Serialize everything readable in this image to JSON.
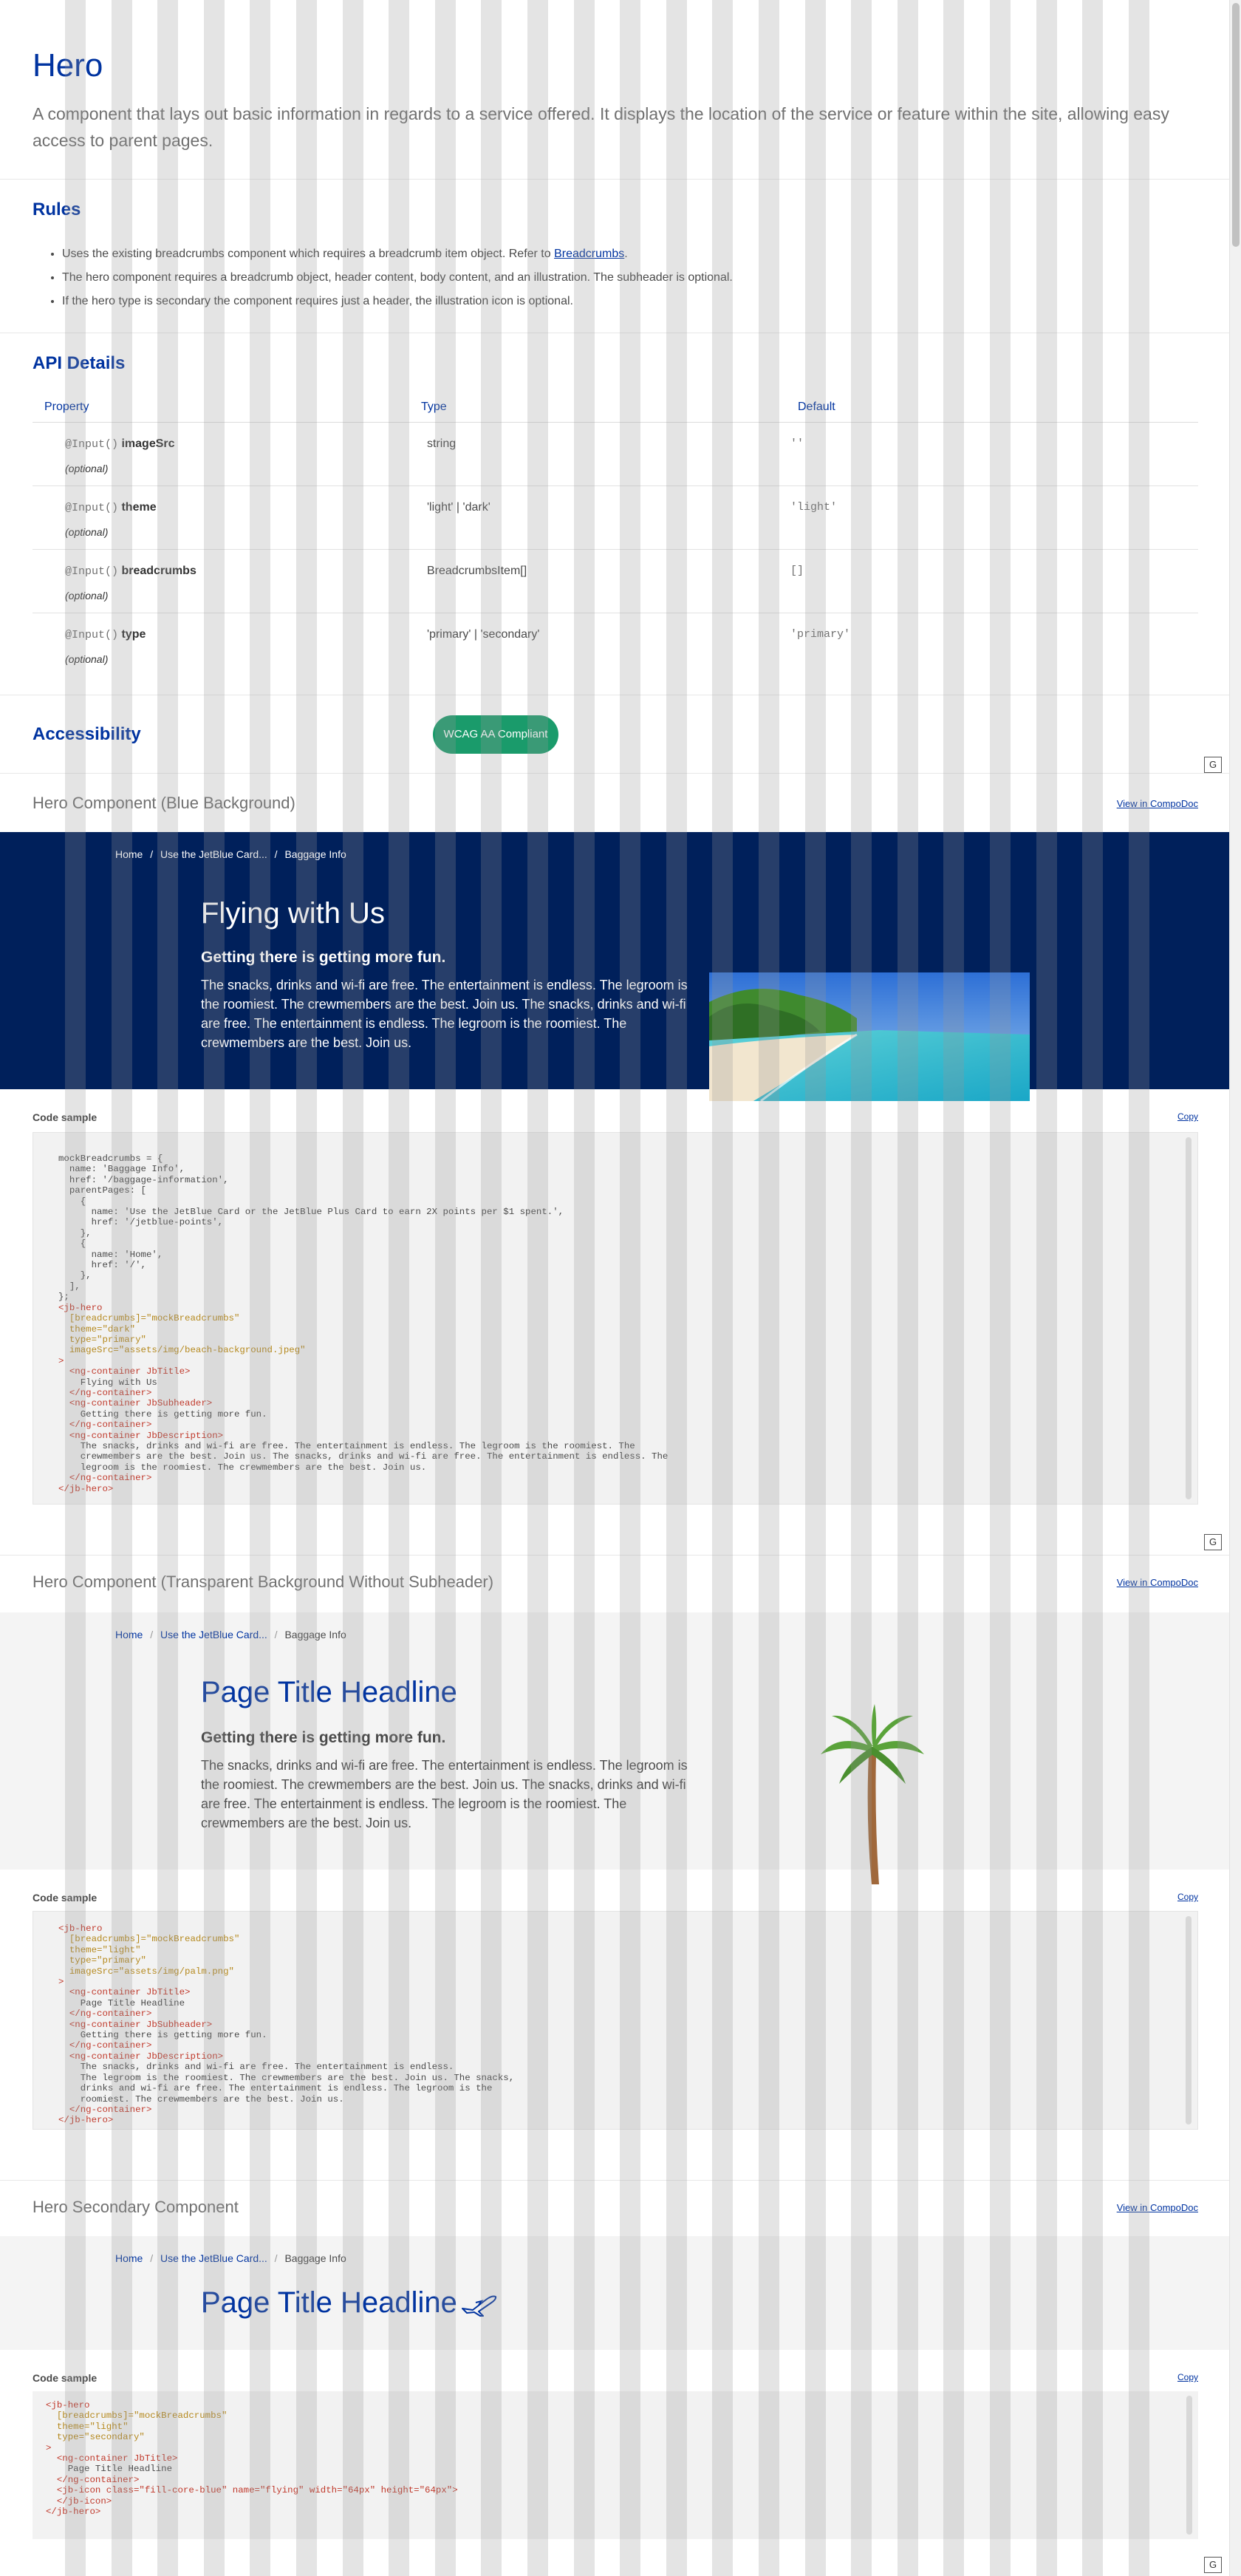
{
  "page": {
    "title": "Hero",
    "description": "A component that lays out basic information in regards to a service offered. It displays the location of the service or feature within the site, allowing easy access to parent pages."
  },
  "rules": {
    "heading": "Rules",
    "item1_prefix": "Uses the existing breadcrumbs component which requires a breadcrumb item object. Refer to",
    "item1_link": "Breadcrumbs",
    "item1_suffix": ".",
    "item2": "The hero component requires a breadcrumb object, header content, body content, and an illustration. The subheader is optional.",
    "item3": "If the hero type is secondary the component requires just a header, the illustration icon is optional."
  },
  "api": {
    "heading": "API Details",
    "columns": [
      "Property",
      "Type",
      "Default"
    ],
    "rows": [
      {
        "decorator": "@Input()",
        "name": "imageSrc",
        "optional": "(optional)",
        "type": "string",
        "default": "''"
      },
      {
        "decorator": "@Input()",
        "name": "theme",
        "optional": "(optional)",
        "type": "'light' | 'dark'",
        "default": "'light'"
      },
      {
        "decorator": "@Input()",
        "name": "breadcrumbs",
        "optional": "(optional)",
        "type": "BreadcrumbsItem[]",
        "default": "[]"
      },
      {
        "decorator": "@Input()",
        "name": "type",
        "optional": "(optional)",
        "type": "'primary' | 'secondary'",
        "default": "'primary'"
      }
    ]
  },
  "accessibility": {
    "heading": "Accessibility",
    "badge": "WCAG AA Compliant"
  },
  "grid_toggle": "G",
  "common": {
    "view_in_compodoc": "View in CompoDoc",
    "code_sample": "Code sample",
    "copy": "Copy"
  },
  "breadcrumb": {
    "home": "Home",
    "middle": "Use the JetBlue Card...",
    "current": "Baggage Info",
    "separator": "/"
  },
  "example1": {
    "title": "Hero Component (Blue Background)",
    "hero_title": "Flying with Us",
    "hero_subheader": "Getting there is getting more fun.",
    "hero_description": "The snacks, drinks and wi-fi are free. The entertainment is endless. The legroom is the roomiest. The crewmembers are the best. Join us. The snacks, drinks and wi-fi are free. The entertainment is endless. The legroom is the roomiest. The crewmembers are the best. Join us.",
    "colors": {
      "background": "#00205b"
    }
  },
  "example2": {
    "title": "Hero Component (Transparent Background Without Subheader)",
    "hero_title": "Page Title Headline",
    "hero_subheader": "Getting there is getting more fun.",
    "hero_description": "The snacks, drinks and wi-fi are free. The entertainment is endless. The legroom is the roomiest. The crewmembers are the best. Join us. The snacks, drinks and wi-fi are free. The entertainment is endless. The legroom is the roomiest. The crewmembers are the best. Join us."
  },
  "example3": {
    "title": "Hero Secondary Component",
    "hero_title": "Page Title Headline",
    "icon": "flying-plane-icon"
  },
  "code_samples": {
    "sample1_l01": "mockBreadcrumbs = {",
    "sample1_l02": "  name: 'Baggage Info',",
    "sample1_l03": "  href: '/baggage-information',",
    "sample1_l04": "  parentPages: [",
    "sample1_l05": "    {",
    "sample1_l06": "      name: 'Use the JetBlue Card or the JetBlue Plus Card to earn 2X points per $1 spent.',",
    "sample1_l07": "      href: '/jetblue-points',",
    "sample1_l08": "    },",
    "sample1_l09": "    {",
    "sample1_l10": "      name: 'Home',",
    "sample1_l11": "      href: '/',",
    "sample1_l12": "    },",
    "sample1_l13": "  ],",
    "sample1_l14": "};",
    "sample1_l15": "<jb-hero",
    "sample1_l16": "  [breadcrumbs]=\"mockBreadcrumbs\"",
    "sample1_l17": "  theme=\"dark\"",
    "sample1_l18": "  type=\"primary\"",
    "sample1_l19": "  imageSrc=\"assets/img/beach-background.jpeg\"",
    "sample1_l20": ">",
    "sample1_l21": "  <ng-container JbTitle>",
    "sample1_l22": "    Flying with Us",
    "sample1_l23": "  </ng-container>",
    "sample1_l24": "  <ng-container JbSubheader>",
    "sample1_l25": "    Getting there is getting more fun.",
    "sample1_l26": "  </ng-container>",
    "sample1_l27": "  <ng-container JbDescription>",
    "sample1_l28": "    The snacks, drinks and wi-fi are free. The entertainment is endless. The legroom is the roomiest. The",
    "sample1_l29": "    crewmembers are the best. Join us. The snacks, drinks and wi-fi are free. The entertainment is endless. The",
    "sample1_l30": "    legroom is the roomiest. The crewmembers are the best. Join us.",
    "sample1_l31": "  </ng-container>",
    "sample1_l32": "</jb-hero>",
    "sample2_l01": "<jb-hero",
    "sample2_l02": "  [breadcrumbs]=\"mockBreadcrumbs\"",
    "sample2_l03": "  theme=\"light\"",
    "sample2_l04": "  type=\"primary\"",
    "sample2_l05": "  imageSrc=\"assets/img/palm.png\"",
    "sample2_l06": ">",
    "sample2_l07": "  <ng-container JbTitle>",
    "sample2_l08": "    Page Title Headline",
    "sample2_l09": "  </ng-container>",
    "sample2_l10": "  <ng-container JbSubheader>",
    "sample2_l11": "    Getting there is getting more fun.",
    "sample2_l12": "  </ng-container>",
    "sample2_l13": "  <ng-container JbDescription>",
    "sample2_l14": "    The snacks, drinks and wi-fi are free. The entertainment is endless.",
    "sample2_l15": "    The legroom is the roomiest. The crewmembers are the best. Join us. The snacks,",
    "sample2_l16": "    drinks and wi-fi are free. The entertainment is endless. The legroom is the",
    "sample2_l17": "    roomiest. The crewmembers are the best. Join us.",
    "sample2_l18": "  </ng-container>",
    "sample2_l19": "</jb-hero>",
    "sample3_l01": "<jb-hero",
    "sample3_l02": "  [breadcrumbs]=\"mockBreadcrumbs\"",
    "sample3_l03": "  theme=\"light\"",
    "sample3_l04": "  type=\"secondary\"",
    "sample3_l05": ">",
    "sample3_l06": "  <ng-container JbTitle>",
    "sample3_l07": "    Page Title Headline",
    "sample3_l08": "  </ng-container>",
    "sample3_l09": "  <jb-icon class=\"fill-core-blue\" name=\"flying\" width=\"64px\" height=\"64px\">",
    "sample3_l10": "  </jb-icon>",
    "sample3_l11": "</jb-hero>"
  },
  "colors": {
    "accent": "#0033a0",
    "badge": "#1a9b6b",
    "code_tag": "#c0392b",
    "code_attr": "#b5891e",
    "code_string": "#2e9b4a"
  }
}
